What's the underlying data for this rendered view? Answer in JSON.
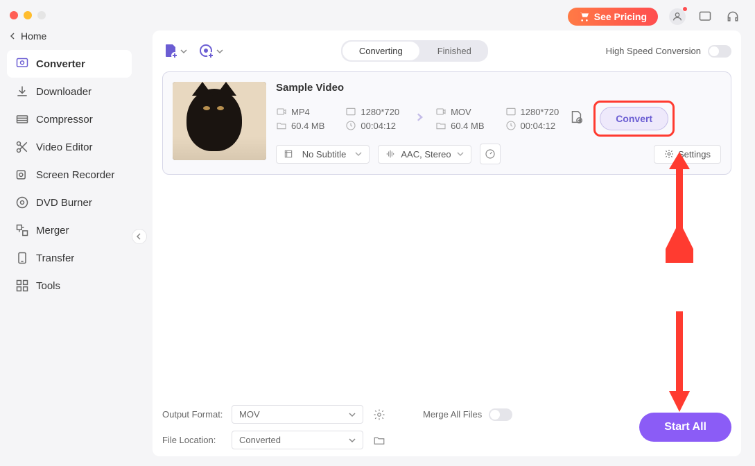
{
  "home_label": "Home",
  "sidebar": {
    "items": [
      {
        "label": "Converter"
      },
      {
        "label": "Downloader"
      },
      {
        "label": "Compressor"
      },
      {
        "label": "Video Editor"
      },
      {
        "label": "Screen Recorder"
      },
      {
        "label": "DVD Burner"
      },
      {
        "label": "Merger"
      },
      {
        "label": "Transfer"
      },
      {
        "label": "Tools"
      }
    ]
  },
  "topbar": {
    "see_pricing": "See Pricing"
  },
  "panel_head": {
    "tabs": {
      "converting": "Converting",
      "finished": "Finished"
    },
    "high_speed": "High Speed Conversion"
  },
  "task": {
    "title": "Sample Video",
    "src": {
      "format": "MP4",
      "resolution": "1280*720",
      "size": "60.4 MB",
      "duration": "00:04:12"
    },
    "dst": {
      "format": "MOV",
      "resolution": "1280*720",
      "size": "60.4 MB",
      "duration": "00:04:12"
    },
    "subtitle": "No Subtitle",
    "audio": "AAC, Stereo",
    "settings": "Settings",
    "convert": "Convert"
  },
  "footer": {
    "output_format_label": "Output Format:",
    "output_format_value": "MOV",
    "file_location_label": "File Location:",
    "file_location_value": "Converted",
    "merge_label": "Merge All Files",
    "start_all": "Start All"
  }
}
